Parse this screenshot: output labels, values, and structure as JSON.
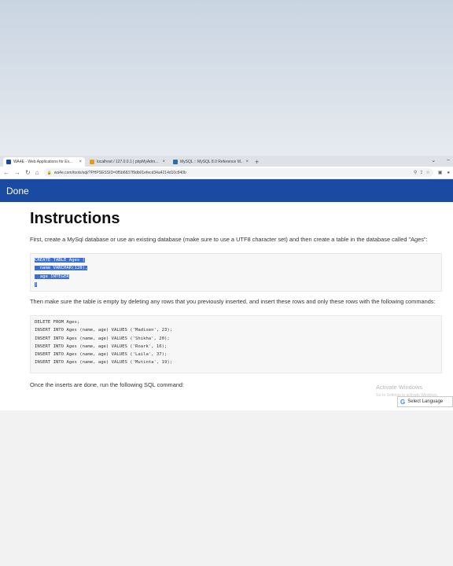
{
  "tabs": [
    {
      "title": "WA4E - Web Applications for Ev...",
      "active": true,
      "favicon_color": "#1b4aa2"
    },
    {
      "title": "localhost / 127.0.0.1 | phpMyAdm...",
      "active": false,
      "favicon_color": "#e69a1a"
    },
    {
      "title": "MySQL :: MySQL 8.0 Reference M...",
      "active": false,
      "favicon_color": "#2a6fa8"
    }
  ],
  "new_tab": "+",
  "window_controls": [
    "⌄",
    "–"
  ],
  "address": {
    "url": "wa4e.com/tools/sql/?PHPSESSID=0f5b6837f9db01efecd34a4214d10c840b"
  },
  "header": {
    "done_label": "Done",
    "color": "#1b4aa2"
  },
  "content": {
    "title": "Instructions",
    "para1": "First, create a MySql database or use an existing database (make sure to use a UTF8 character set) and then create a table in the database called \"Ages\":",
    "code1_lines": [
      "CREATE TABLE Ages (",
      "  name VARCHAR(128),",
      "  age INTEGER",
      ")"
    ],
    "para2": "Then make sure the table is empty by deleting any rows that you previously inserted, and insert these rows and only these rows with the following commands:",
    "code2_lines": [
      "DELETE FROM Ages;",
      "INSERT INTO Ages (name, age) VALUES ('Madisen', 23);",
      "INSERT INTO Ages (name, age) VALUES ('Shikha', 20);",
      "INSERT INTO Ages (name, age) VALUES ('Roark', 16);",
      "INSERT INTO Ages (name, age) VALUES ('Laila', 37);",
      "INSERT INTO Ages (name, age) VALUES ('Mutinta', 19);"
    ],
    "para3": "Once the inserts are done, run the following SQL command:"
  },
  "overlay": {
    "watermark": "Activate Windows",
    "watermark_sub": "Go to Settings to activate Windows.",
    "translate_label": "Select Language"
  }
}
